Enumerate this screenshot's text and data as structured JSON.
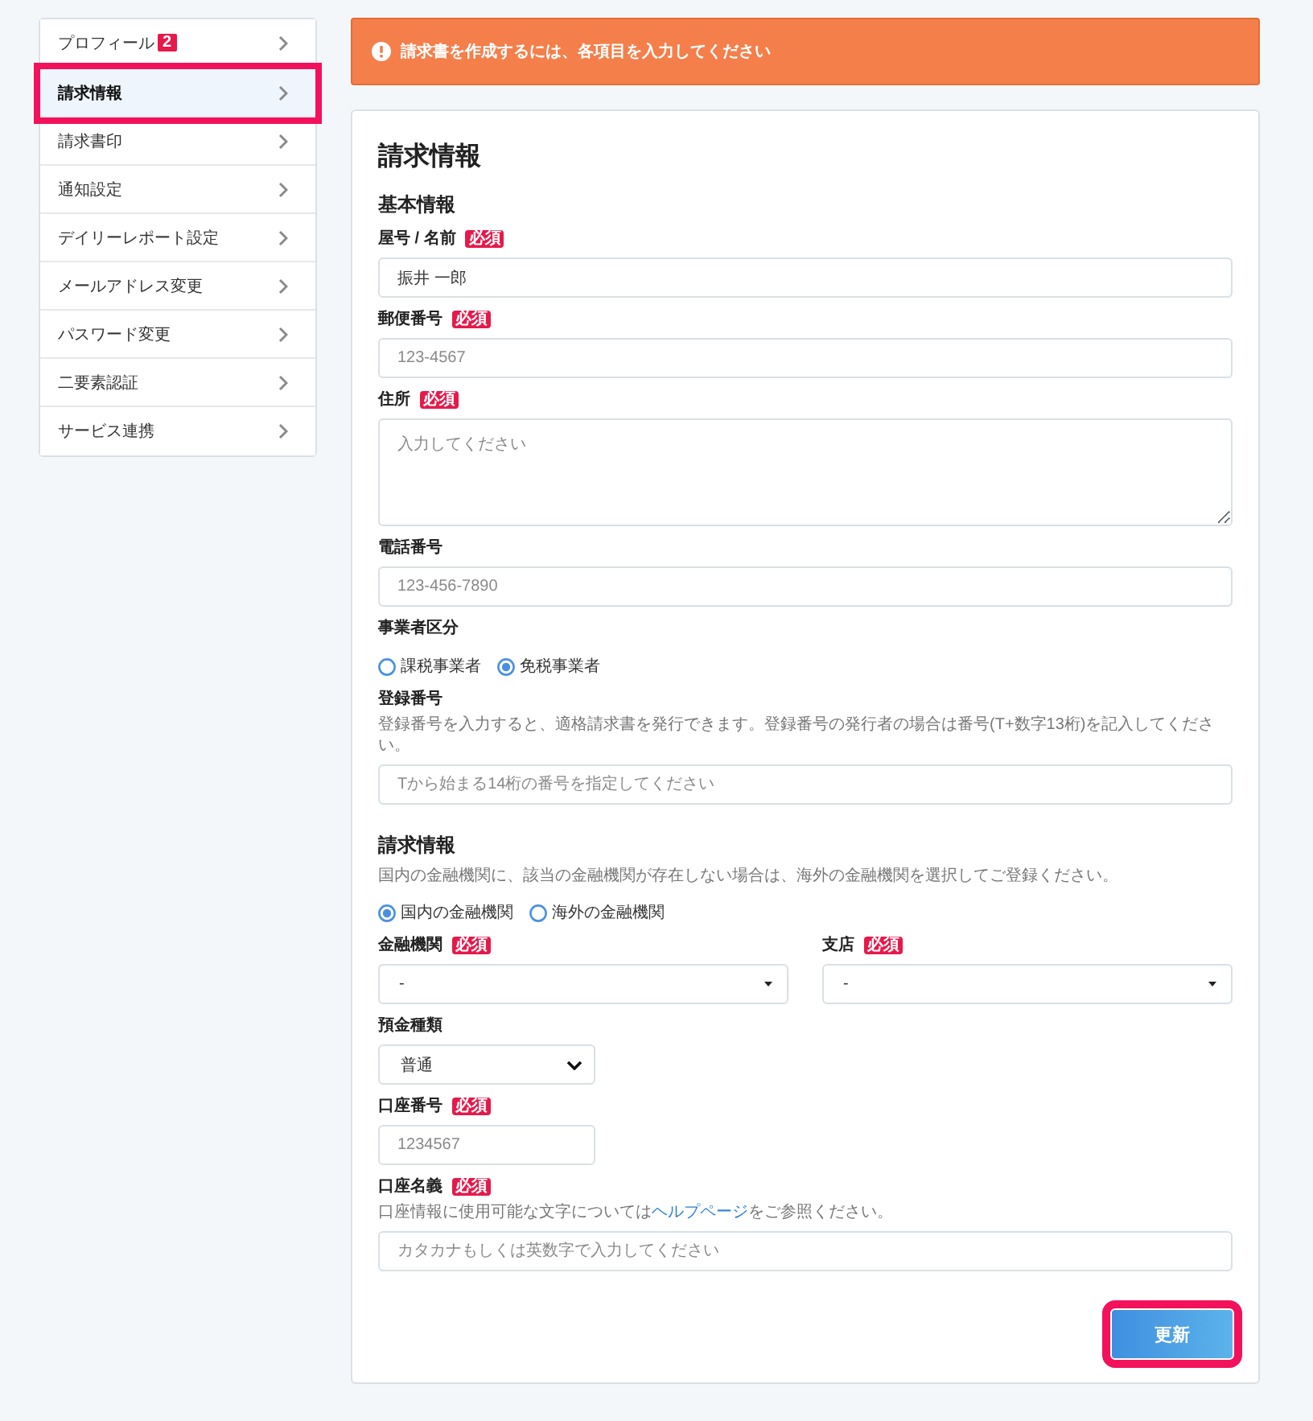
{
  "sidebar": {
    "items": [
      {
        "label": "プロフィール",
        "badge": "2",
        "selected": false,
        "highlighted": false
      },
      {
        "label": "請求情報",
        "selected": true,
        "highlighted": true
      },
      {
        "label": "請求書印",
        "selected": false,
        "highlighted": false
      },
      {
        "label": "通知設定",
        "selected": false,
        "highlighted": false
      },
      {
        "label": "デイリーレポート設定",
        "selected": false,
        "highlighted": false
      },
      {
        "label": "メールアドレス変更",
        "selected": false,
        "highlighted": false
      },
      {
        "label": "パスワード変更",
        "selected": false,
        "highlighted": false
      },
      {
        "label": "二要素認証",
        "selected": false,
        "highlighted": false
      },
      {
        "label": "サービス連携",
        "selected": false,
        "highlighted": false
      }
    ]
  },
  "alert": {
    "message": "請求書を作成するには、各項目を入力してください"
  },
  "form": {
    "title": "請求情報",
    "sections": [
      {
        "heading": "基本情報",
        "fields": [
          {
            "kind": "text",
            "label": "屋号 / 名前",
            "badge": "必須",
            "value": "振井 一郎"
          },
          {
            "kind": "text",
            "label": "郵便番号",
            "badge": "必須",
            "placeholder": "123-4567"
          },
          {
            "kind": "textarea",
            "label": "住所",
            "badge": "必須",
            "placeholder": "入力してください"
          },
          {
            "kind": "text",
            "label": "電話番号",
            "placeholder": "123-456-7890"
          },
          {
            "kind": "radio",
            "label": "事業者区分",
            "options": [
              {
                "label": "課税事業者",
                "selected": false
              },
              {
                "label": "免税事業者",
                "selected": true
              }
            ]
          },
          {
            "kind": "text",
            "label": "登録番号",
            "note": [
              {
                "kind": "text",
                "text": "登録番号を入力すると、適格請求書を発行できます。登録番号の発行者の場合は番号(T+数字13桁)を記入してください。"
              }
            ],
            "placeholder": "Tから始まる14桁の番号を指定してください"
          }
        ]
      },
      {
        "heading": "請求情報",
        "description": "国内の金融機関に、該当の金融機関が存在しない場合は、海外の金融機関を選択してご登録ください。",
        "fields": [
          {
            "kind": "radio",
            "options": [
              {
                "label": "国内の金融機関",
                "selected": true
              },
              {
                "label": "海外の金融機関",
                "selected": false
              }
            ]
          },
          {
            "kind": "columns",
            "fields": [
              {
                "kind": "dropdown",
                "label": "金融機関",
                "badge": "必須",
                "value": "-"
              },
              {
                "kind": "dropdown",
                "label": "支店",
                "badge": "必須",
                "value": "-"
              }
            ]
          },
          {
            "kind": "select",
            "label": "預金種類",
            "value": "普通"
          },
          {
            "kind": "short_text",
            "label": "口座番号",
            "badge": "必須",
            "placeholder": "1234567"
          },
          {
            "kind": "text",
            "label": "口座名義",
            "badge": "必須",
            "note": [
              {
                "kind": "text",
                "text": "口座情報に使用可能な文字については"
              },
              {
                "kind": "link",
                "text": "ヘルプページ"
              },
              {
                "kind": "text",
                "text": "をご参照ください。"
              }
            ],
            "placeholder": "カタカナもしくは英数字で入力してください"
          }
        ]
      }
    ],
    "submit": {
      "label": "更新",
      "highlighted": true
    }
  }
}
